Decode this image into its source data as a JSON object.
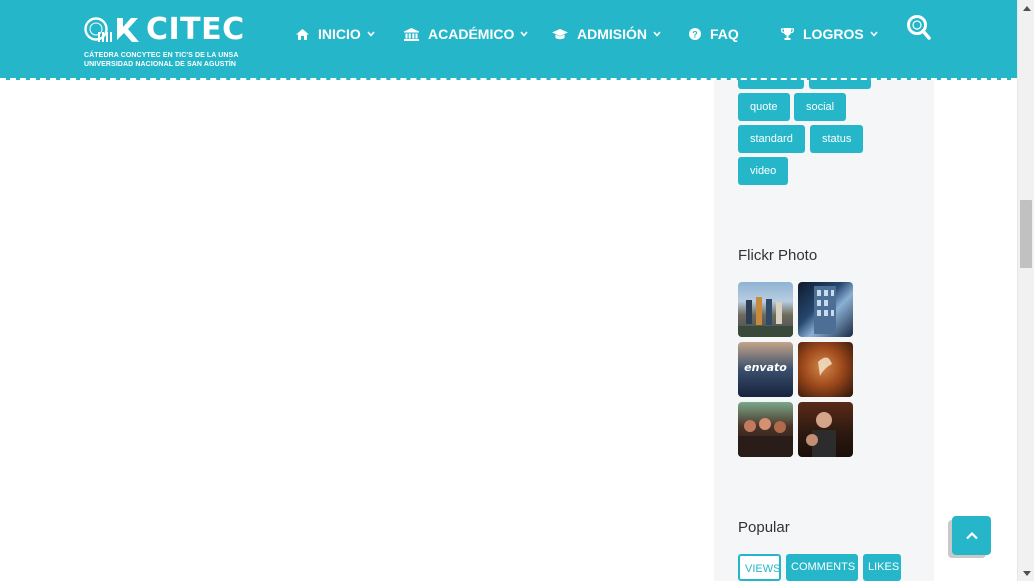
{
  "header": {
    "logo_text": "CITEC",
    "logo_subtitle_1": "CÁTEDRA CONCYTEC EN TIC'S DE LA UNSA",
    "logo_subtitle_2": "UNIVERSIDAD NACIONAL DE SAN AGUSTÍN",
    "brand_color": "#25b7c9"
  },
  "nav": {
    "items": [
      {
        "label": "INICIO",
        "icon": "home-icon"
      },
      {
        "label": "ACADÉMICO",
        "icon": "institution-icon"
      },
      {
        "label": "ADMISIÓN",
        "icon": "graduation-cap-icon"
      },
      {
        "label": "FAQ",
        "icon": "question-circle-icon"
      },
      {
        "label": "LOGROS",
        "icon": "trophy-icon"
      }
    ],
    "search_icon": "search-icon"
  },
  "sidebar": {
    "tags": [
      "quote",
      "social",
      "standard",
      "status",
      "video"
    ],
    "flickr": {
      "title": "Flickr Photo",
      "photos": [
        {
          "name": "group-photo"
        },
        {
          "name": "building-photo"
        },
        {
          "name": "envato-photo",
          "label": "envato"
        },
        {
          "name": "leaf-photo"
        },
        {
          "name": "crowd-photo"
        },
        {
          "name": "portrait-photo"
        }
      ]
    },
    "popular": {
      "title": "Popular",
      "tabs": [
        "VIEWS",
        "COMMENTS",
        "LIKES"
      ]
    }
  },
  "back_to_top_icon": "chevron-up-icon"
}
